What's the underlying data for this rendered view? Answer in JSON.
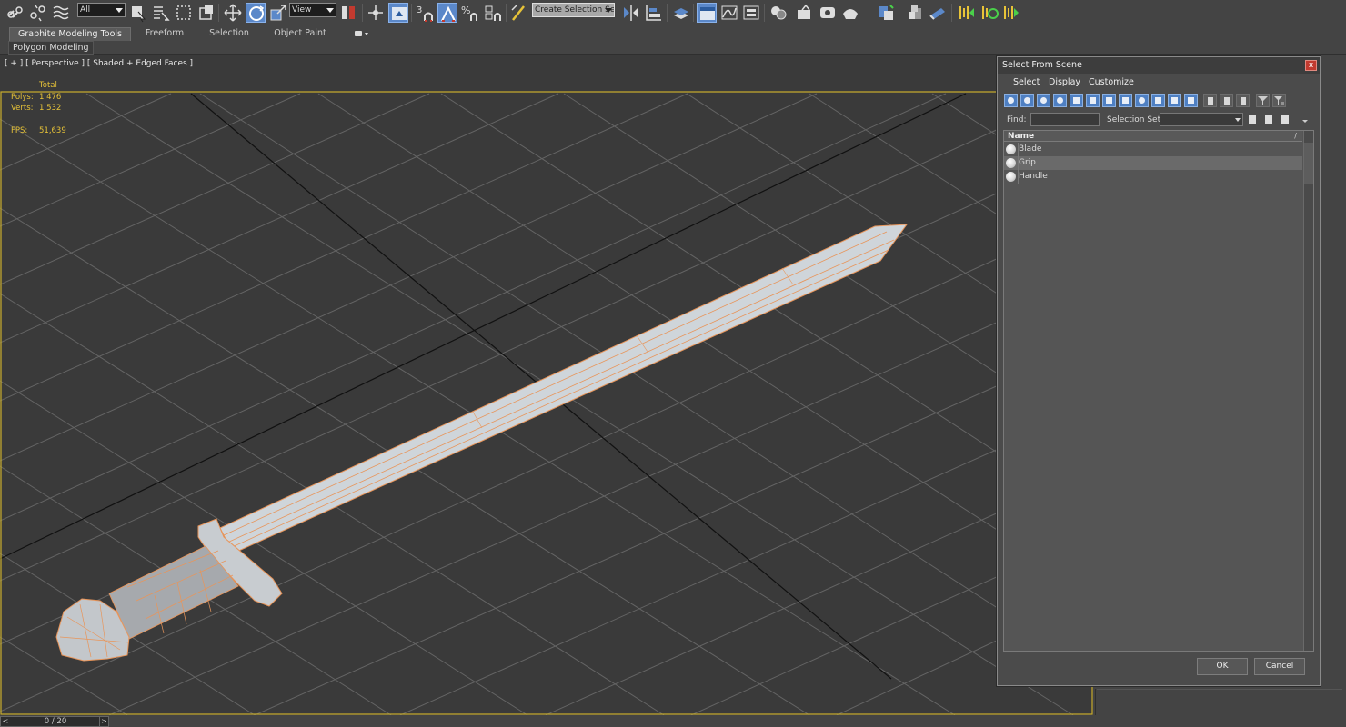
{
  "toolbar": {
    "selection_filter": "All",
    "reference_coord": "View",
    "named_selection": "Create Selection Se",
    "snap_label": "3",
    "percent_snap": "%"
  },
  "ribbon": {
    "tabs": [
      {
        "label": "Graphite Modeling Tools",
        "active": true
      },
      {
        "label": "Freeform",
        "active": false
      },
      {
        "label": "Selection",
        "active": false
      },
      {
        "label": "Object Paint",
        "active": false
      }
    ],
    "panel_label": "Polygon Modeling"
  },
  "viewport": {
    "label": "[ + ] [ Perspective ] [ Shaded + Edged Faces ]",
    "stats": {
      "header": "Total",
      "polys_label": "Polys:",
      "polys_value": "1 476",
      "verts_label": "Verts:",
      "verts_value": "1 532",
      "fps_label": "FPS:",
      "fps_value": "51,639"
    }
  },
  "dialog": {
    "title": "Select From Scene",
    "close": "x",
    "menu": [
      "Select",
      "Display",
      "Customize"
    ],
    "find_label": "Find:",
    "find_value": "",
    "selection_set_label": "Selection Set:",
    "list_header": "Name",
    "list_sort_indicator": "/",
    "objects": [
      {
        "name": "Blade",
        "selected": false
      },
      {
        "name": "Grip",
        "selected": true
      },
      {
        "name": "Handle",
        "selected": false
      }
    ],
    "ok_label": "OK",
    "cancel_label": "Cancel"
  },
  "statusbar": {
    "frame": "0 / 20",
    "prev": "<",
    "next": ">"
  },
  "colors": {
    "viewport_bg": "#3a3a3a",
    "grid": "#6a6a6a",
    "wire": "#e8955a",
    "sword_fill": "#d5dbe0",
    "stats_text": "#e7c338",
    "viewport_border": "#c9ad2e",
    "accent_blue": "#4e7fc2"
  }
}
